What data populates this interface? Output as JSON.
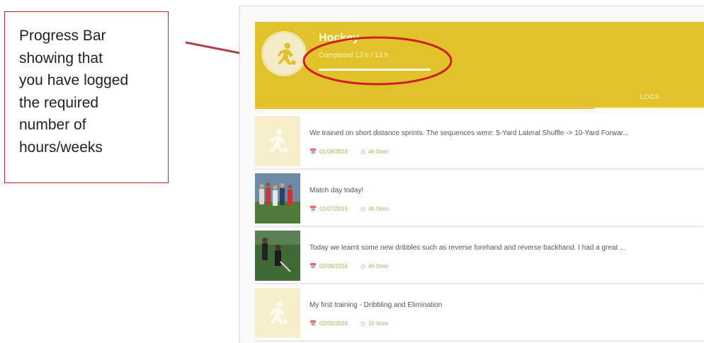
{
  "callout": {
    "text": "Progress Bar\nshowing that\nyou have logged\nthe required\nnumber of\nhours/weeks"
  },
  "header": {
    "title": "Hockey",
    "subtitle": "Completed 13 h / 13 h",
    "progress_fraction": 1.0,
    "tab_label": "LOGS",
    "avatar_icon": "soccer-player-icon"
  },
  "logs": [
    {
      "text": "We trained on short distance sprints. The sequences were: 5-Yard Lateral Shuffle -> 10-Yard Forwar...",
      "date": "01/08/2016",
      "duration": "4h 0min",
      "thumb": "placeholder"
    },
    {
      "text": "Match day today!",
      "date": "01/07/2016",
      "duration": "4h 0min",
      "thumb": "photo-team"
    },
    {
      "text": "Today we learnt some new dribbles such as reverse forehand and reverse backhand. I had a great ...",
      "date": "02/06/2016",
      "duration": "4h 0min",
      "thumb": "photo-dribble"
    },
    {
      "text": "My first training - Dribbling and Elimination",
      "date": "02/05/2016",
      "duration": "1h 0min",
      "thumb": "placeholder"
    }
  ],
  "colors": {
    "accent": "#e2c22a",
    "annotation_red": "#d01c24",
    "arrow": "#b04048"
  }
}
